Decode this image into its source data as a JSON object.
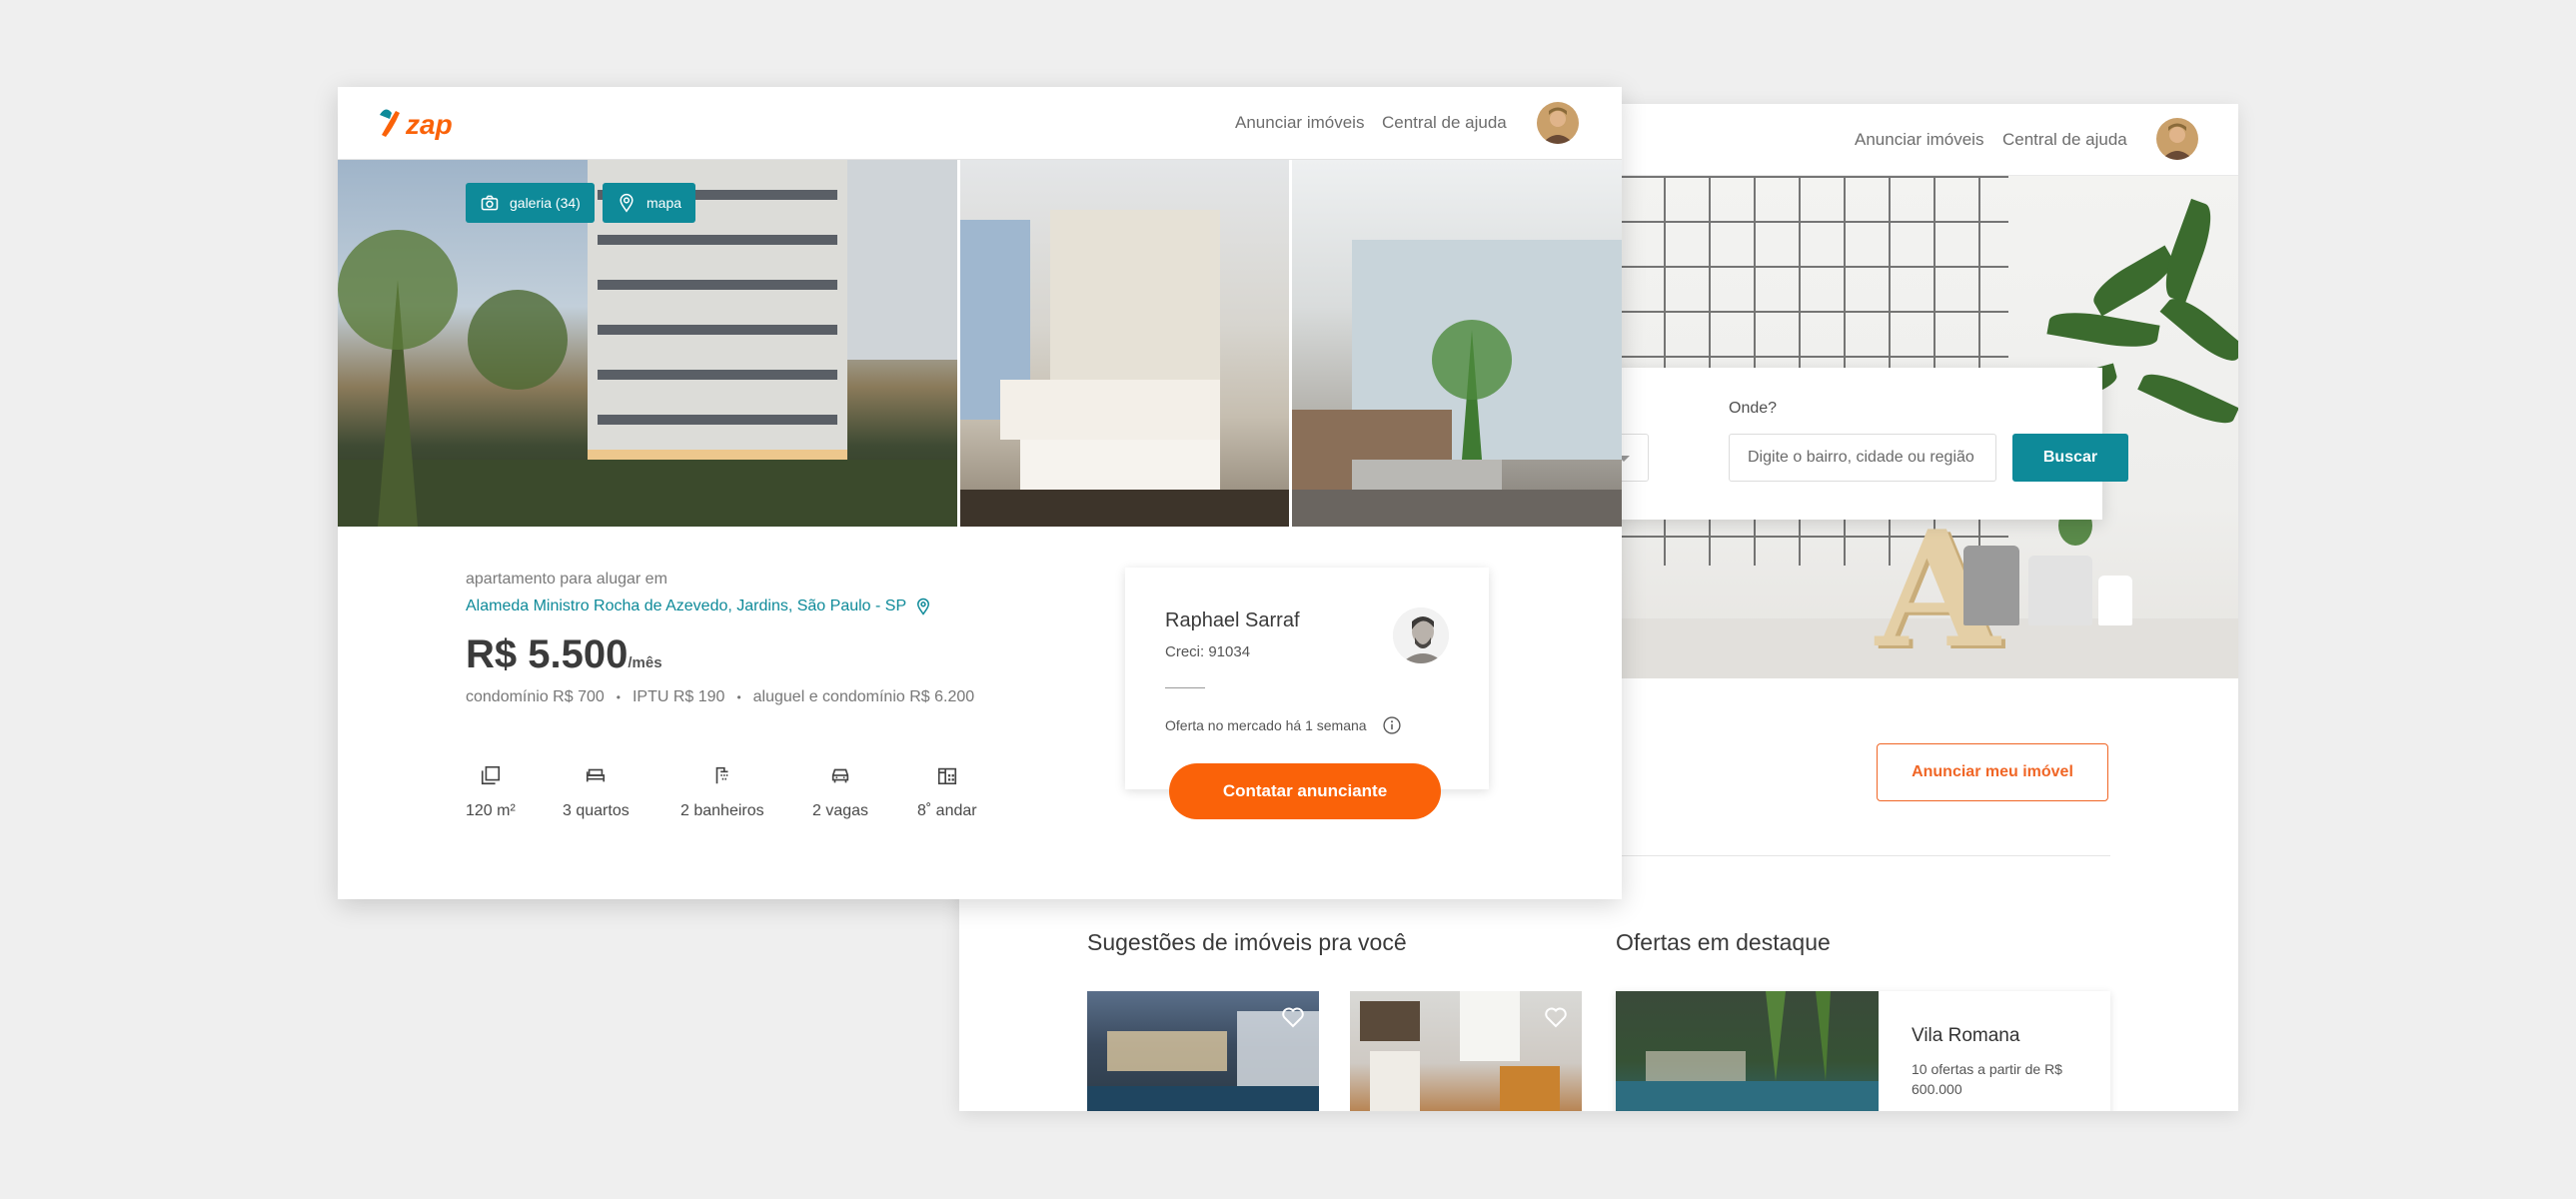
{
  "back_window": {
    "header": {
      "nav_announce": "Anunciar imóveis",
      "nav_help": "Central de ajuda"
    },
    "search": {
      "where_label": "Onde?",
      "where_placeholder": "Digite o bairro, cidade ou região",
      "search_button": "Buscar"
    },
    "announce_button": "Anunciar meu imóvel",
    "suggestions_title": "Sugestões de imóveis pra você",
    "featured_title": "Ofertas em destaque",
    "featured_card": {
      "name": "Vila Romana",
      "description": "10 ofertas a partir de R$ 600.000"
    }
  },
  "front_window": {
    "header": {
      "logo": "zap",
      "nav_announce": "Anunciar imóveis",
      "nav_help": "Central de ajuda"
    },
    "media_buttons": {
      "gallery": "galeria (34)",
      "map": "mapa"
    },
    "listing": {
      "type": "apartamento para alugar em",
      "address": "Alameda Ministro Rocha de Azevedo, Jardins, São Paulo - SP",
      "price": "R$ 5.500",
      "price_unit": "/mês",
      "fees": [
        "condomínio R$ 700",
        "IPTU R$ 190",
        "aluguel e condomínio R$ 6.200"
      ],
      "features": [
        {
          "icon": "area-icon",
          "label": "120 m²"
        },
        {
          "icon": "bed-icon",
          "label": "3 quartos"
        },
        {
          "icon": "shower-icon",
          "label": "2 banheiros"
        },
        {
          "icon": "car-icon",
          "label": "2 vagas"
        },
        {
          "icon": "building-icon",
          "label": "8˚ andar"
        }
      ]
    },
    "agent": {
      "name": "Raphael Sarraf",
      "creci": "Creci: 91034",
      "market_time": "Oferta no mercado há 1 semana",
      "contact_button": "Contatar anunciante"
    }
  },
  "colors": {
    "brand_orange": "#fa6209",
    "teal": "#0e8a99",
    "announce_orange": "#f06626"
  }
}
